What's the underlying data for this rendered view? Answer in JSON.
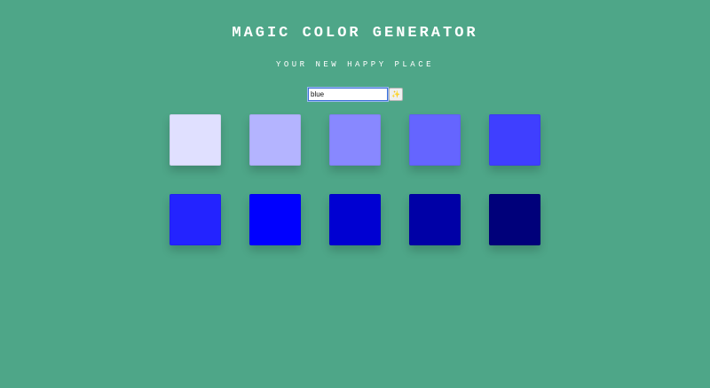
{
  "header": {
    "title": "MAGIC COLOR GENERATOR",
    "subtitle": "YOUR NEW HAPPY PLACE"
  },
  "search": {
    "value": "blue",
    "button_icon": "sparkle-icon",
    "button_glyph": "✨"
  },
  "colors": {
    "background": "#4ea688",
    "accent": "#3b6fd8"
  },
  "swatches": [
    "#e0e0ff",
    "#b4b4ff",
    "#8888ff",
    "#6565ff",
    "#3f3fff",
    "#2323ff",
    "#0000ff",
    "#0000d2",
    "#0000a6",
    "#00007a"
  ]
}
